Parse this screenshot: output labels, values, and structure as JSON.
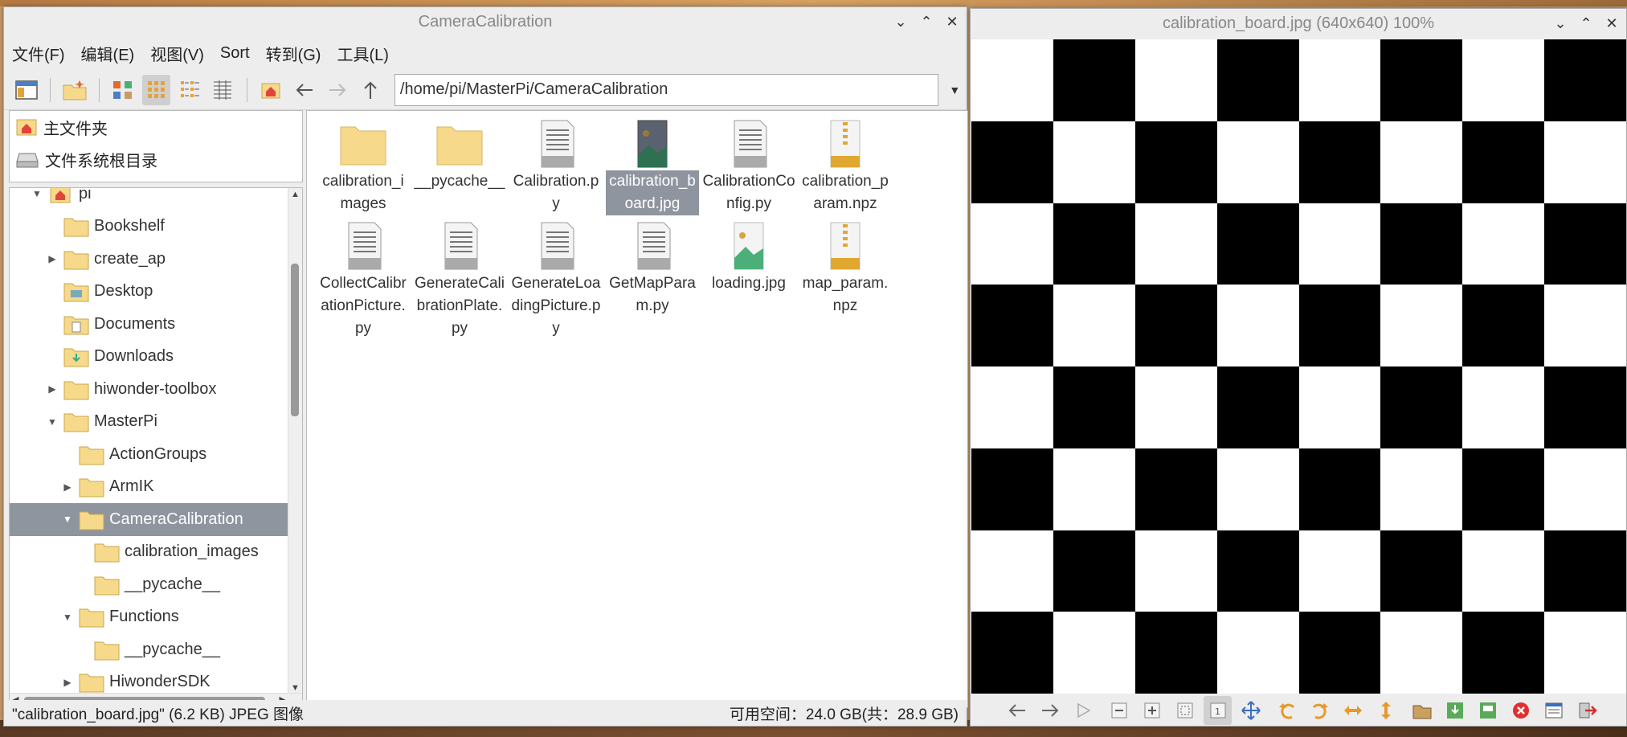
{
  "file_manager": {
    "title": "CameraCalibration",
    "menu": [
      "文件(F)",
      "编辑(E)",
      "视图(V)",
      "Sort",
      "转到(G)",
      "工具(L)"
    ],
    "path": "/home/pi/MasterPi/CameraCalibration",
    "places": [
      {
        "label": "主文件夹",
        "icon": "home-icon"
      },
      {
        "label": "文件系统根目录",
        "icon": "drive-icon"
      }
    ],
    "tree": [
      {
        "label": "pi",
        "depth": 0,
        "arrow": "down",
        "icon": "home-folder"
      },
      {
        "label": "Bookshelf",
        "depth": 1,
        "arrow": "",
        "icon": "folder"
      },
      {
        "label": "create_ap",
        "depth": 1,
        "arrow": "right",
        "icon": "folder"
      },
      {
        "label": "Desktop",
        "depth": 1,
        "arrow": "",
        "icon": "desktop-folder"
      },
      {
        "label": "Documents",
        "depth": 1,
        "arrow": "",
        "icon": "documents-folder"
      },
      {
        "label": "Downloads",
        "depth": 1,
        "arrow": "",
        "icon": "downloads-folder"
      },
      {
        "label": "hiwonder-toolbox",
        "depth": 1,
        "arrow": "right",
        "icon": "folder"
      },
      {
        "label": "MasterPi",
        "depth": 1,
        "arrow": "down",
        "icon": "folder"
      },
      {
        "label": "ActionGroups",
        "depth": 2,
        "arrow": "",
        "icon": "folder"
      },
      {
        "label": "ArmIK",
        "depth": 2,
        "arrow": "right",
        "icon": "folder"
      },
      {
        "label": "CameraCalibration",
        "depth": 2,
        "arrow": "down",
        "icon": "folder",
        "selected": true
      },
      {
        "label": "calibration_images",
        "depth": 3,
        "arrow": "",
        "icon": "folder"
      },
      {
        "label": "__pycache__",
        "depth": 3,
        "arrow": "",
        "icon": "folder"
      },
      {
        "label": "Functions",
        "depth": 2,
        "arrow": "down",
        "icon": "folder"
      },
      {
        "label": "__pycache__",
        "depth": 3,
        "arrow": "",
        "icon": "folder"
      },
      {
        "label": "HiwonderSDK",
        "depth": 2,
        "arrow": "right",
        "icon": "folder"
      }
    ],
    "files": [
      {
        "label": "calibration_images",
        "type": "folder"
      },
      {
        "label": "__pycache__",
        "type": "folder"
      },
      {
        "label": "Calibration.py",
        "type": "text"
      },
      {
        "label": "calibration_board.jpg",
        "type": "image-dark",
        "selected": true
      },
      {
        "label": "CalibrationConfig.py",
        "type": "text"
      },
      {
        "label": "calibration_param.npz",
        "type": "archive"
      },
      {
        "label": "CollectCalibrationPicture.py",
        "type": "text"
      },
      {
        "label": "GenerateCalibrationPlate.py",
        "type": "text"
      },
      {
        "label": "GenerateLoadingPicture.py",
        "type": "text"
      },
      {
        "label": "GetMapParam.py",
        "type": "text"
      },
      {
        "label": "loading.jpg",
        "type": "image"
      },
      {
        "label": "map_param.npz",
        "type": "archive"
      }
    ],
    "status_left": "\"calibration_board.jpg\" (6.2 KB) JPEG 图像",
    "status_right": "可用空间：24.0 GB(共：28.9 GB)"
  },
  "image_viewer": {
    "title": "calibration_board.jpg (640x640) 100%",
    "board_size": 8,
    "toolbar": [
      "prev-icon",
      "next-icon",
      "play-icon",
      "zoom-out-icon",
      "zoom-in-icon",
      "fit-icon",
      "original-size-icon",
      "fullscreen-icon",
      "rotate-left-icon",
      "rotate-right-icon",
      "flip-horizontal-icon",
      "flip-vertical-icon",
      "open-icon",
      "save-icon",
      "save-as-icon",
      "delete-icon",
      "preferences-icon",
      "quit-icon"
    ]
  },
  "colors": {
    "selection": "#8f959f",
    "folder": "#f7d98b",
    "archive": "#e0a830",
    "image_green": "#4caf7a"
  }
}
